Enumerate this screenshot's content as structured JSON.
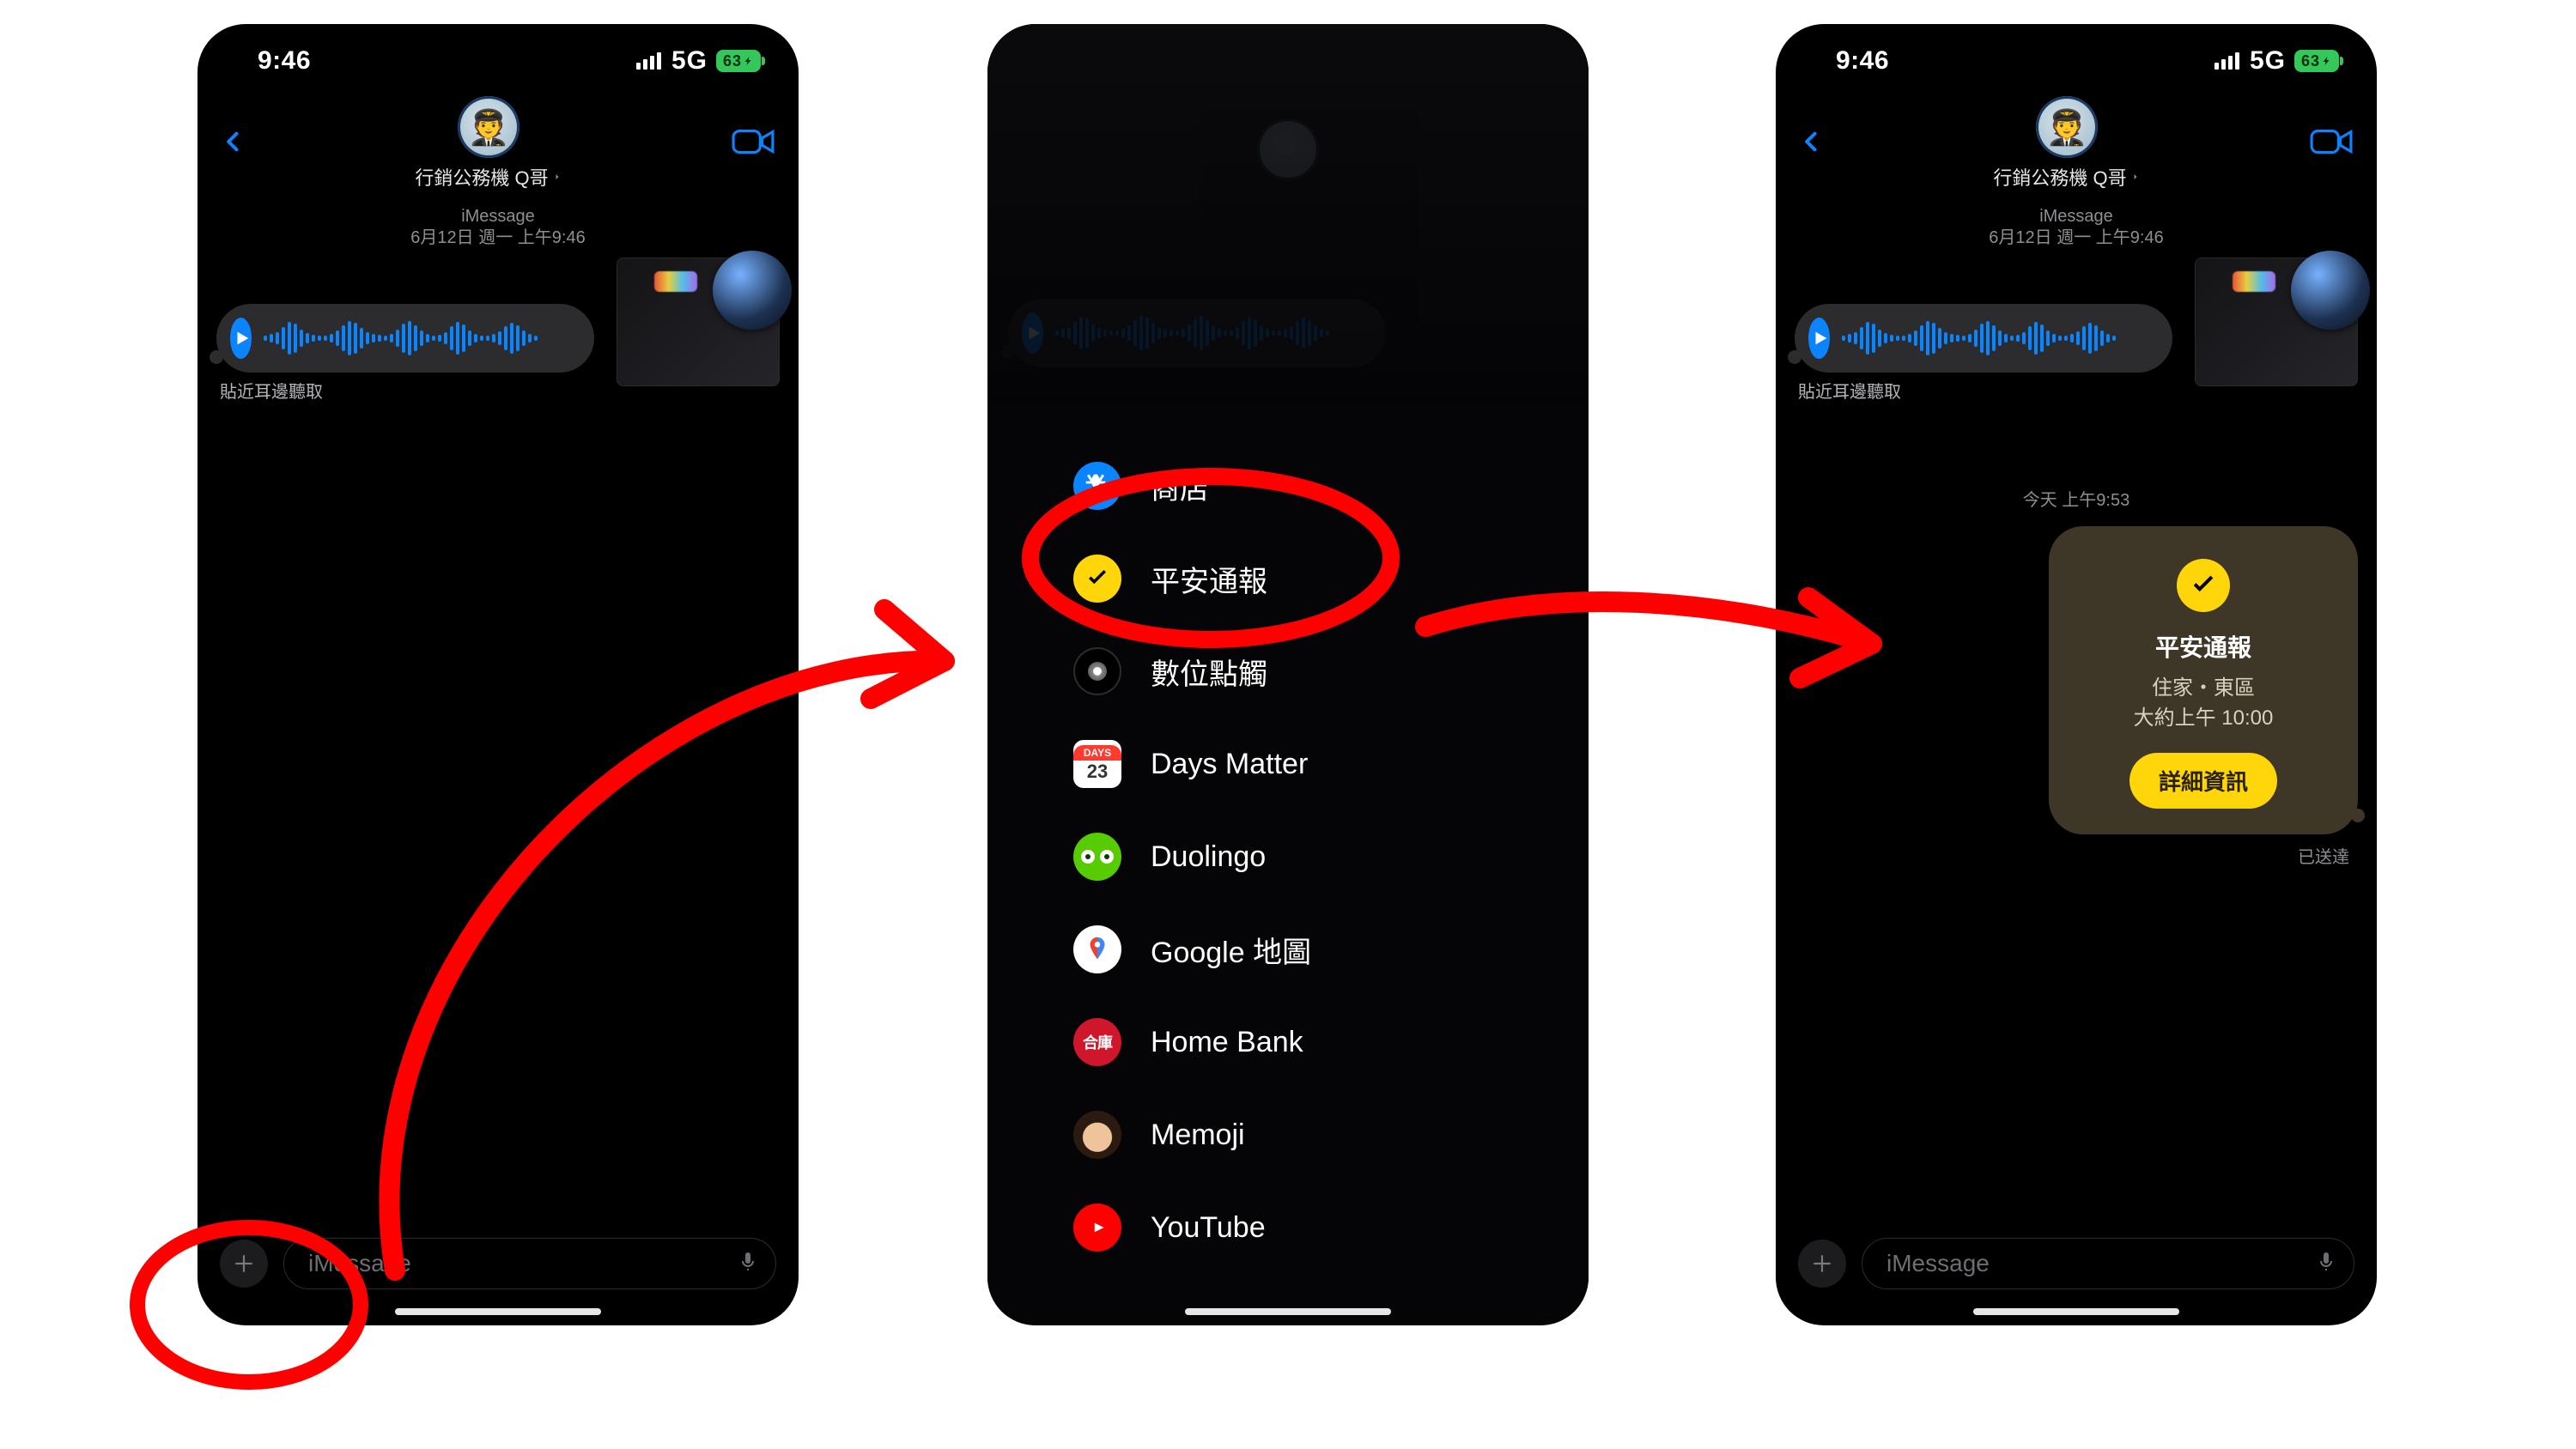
{
  "status": {
    "time": "9:46",
    "network": "5G",
    "battery": "63"
  },
  "chat": {
    "contact_name": "行銷公務機 Q哥",
    "service_label": "iMessage",
    "date_line": "6月12日 週一 上午9:46",
    "ear_hint": "貼近耳邊聽取",
    "today_line": "今天 上午9:53",
    "delivered": "已送達",
    "input_placeholder": "iMessage"
  },
  "checkin_card": {
    "title": "平安通報",
    "location": "住家・東區",
    "eta": "大約上午 10:00",
    "button": "詳細資訊"
  },
  "app_menu": [
    {
      "id": "store",
      "label": "商店"
    },
    {
      "id": "checkin",
      "label": "平安通報"
    },
    {
      "id": "touch",
      "label": "數位點觸"
    },
    {
      "id": "days",
      "label": "Days Matter",
      "badge": "23"
    },
    {
      "id": "duo",
      "label": "Duolingo"
    },
    {
      "id": "gmap",
      "label": "Google 地圖"
    },
    {
      "id": "home",
      "label": "Home Bank"
    },
    {
      "id": "memoji",
      "label": "Memoji"
    },
    {
      "id": "youtube",
      "label": "YouTube"
    }
  ],
  "colors": {
    "blue": "#0a84ff",
    "yellow": "#ffd60a",
    "red": "#ff0000"
  }
}
